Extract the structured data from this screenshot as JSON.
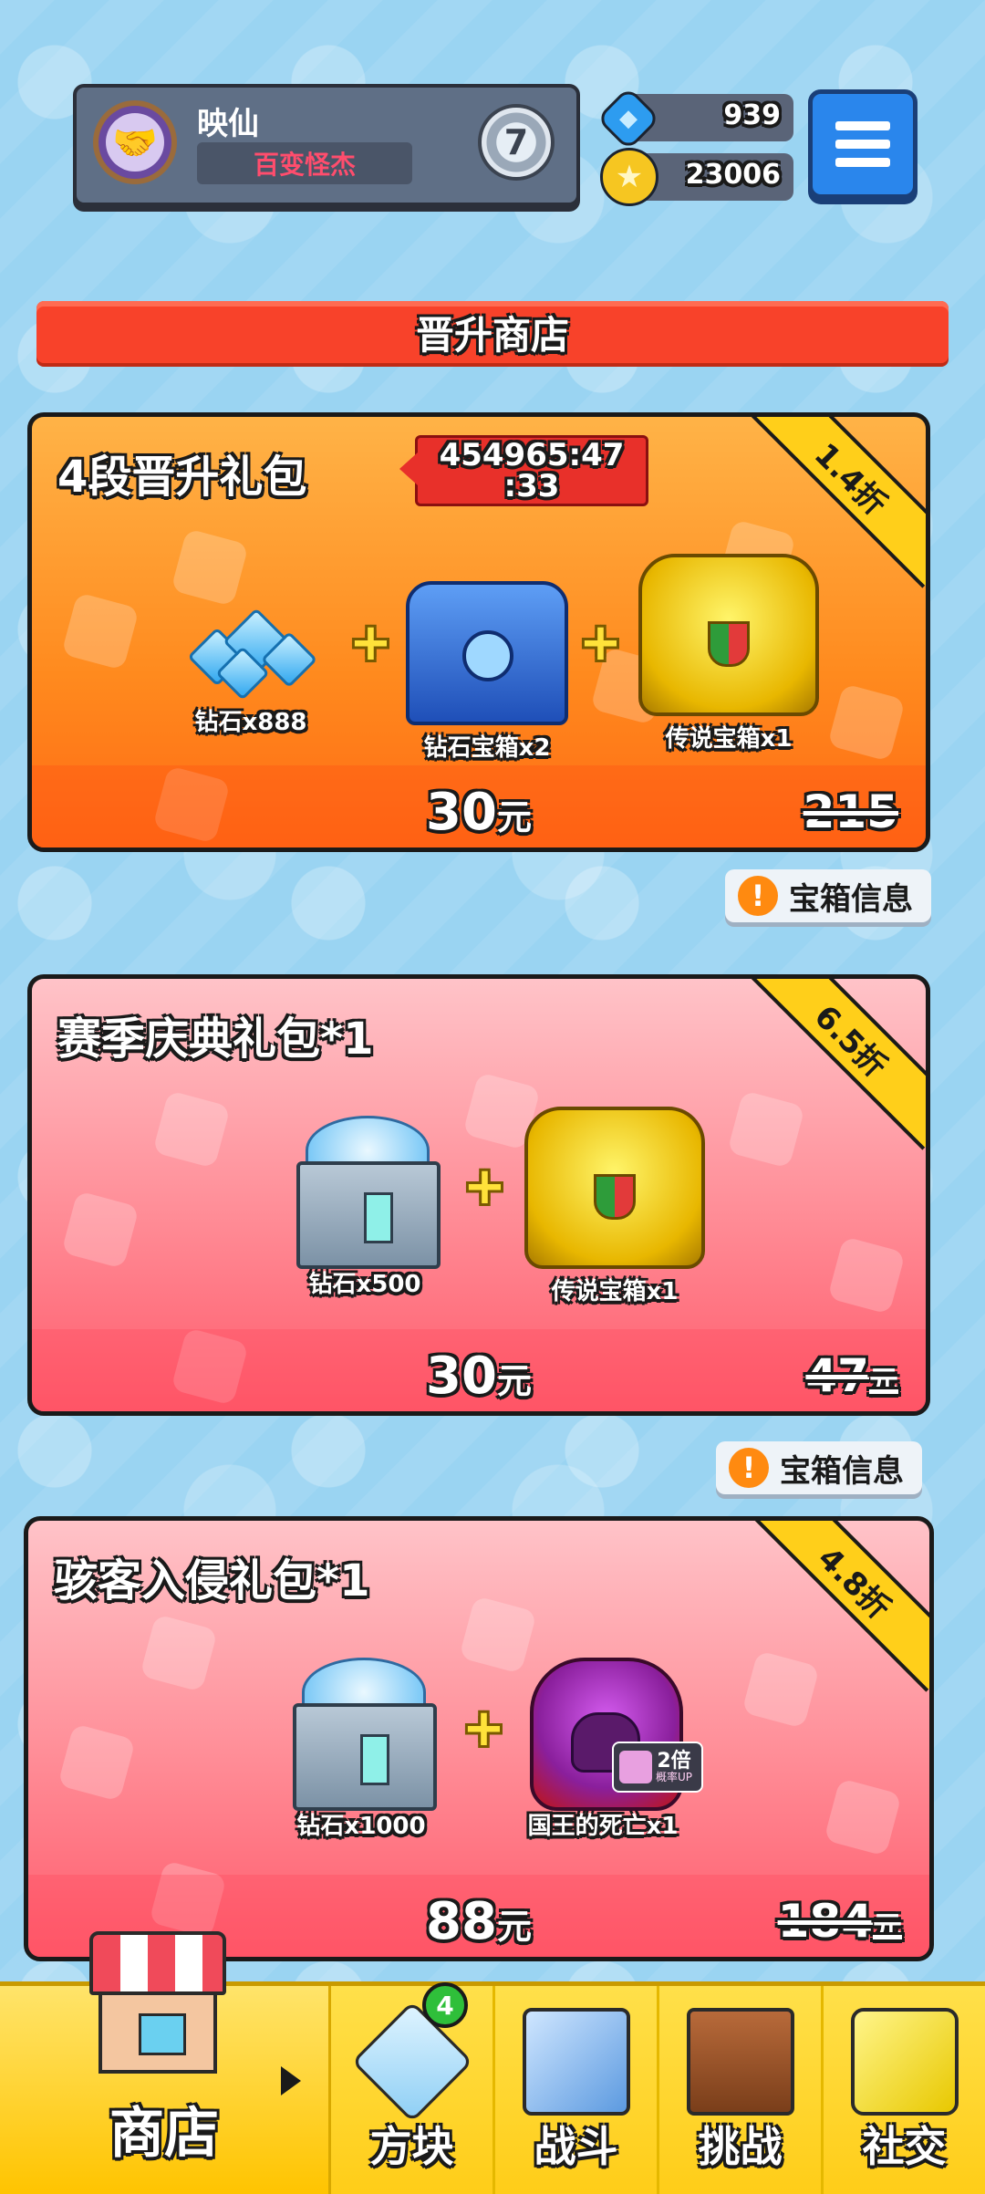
{
  "header": {
    "player_name": "映仙",
    "player_title": "百变怪杰",
    "rank": "7",
    "gems": "939",
    "coins": "23006"
  },
  "section_title": "晋升商店",
  "cards": [
    {
      "title": "4段晋升礼包",
      "timer_line1": "454965:47",
      "timer_line2": ":33",
      "discount": "1.4折",
      "items": [
        "钻石x888",
        "钻石宝箱x2",
        "传说宝箱x1"
      ],
      "price": "30",
      "price_unit": "元",
      "old_price": "215",
      "old_unit": ""
    },
    {
      "title": "赛季庆典礼包*1",
      "discount": "6.5折",
      "items": [
        "钻石x500",
        "传说宝箱x1"
      ],
      "price": "30",
      "price_unit": "元",
      "old_price": "47",
      "old_unit": "元"
    },
    {
      "title": "骇客入侵礼包*1",
      "discount": "4.8折",
      "items": [
        "钻石x1000",
        "国王的死亡x1"
      ],
      "badge_main": "2倍",
      "badge_sub": "概率UP",
      "price": "88",
      "price_unit": "元",
      "old_price": "184",
      "old_unit": "元"
    }
  ],
  "info_button": "宝箱信息",
  "nav": {
    "shop": "商店",
    "blocks": "方块",
    "blocks_badge": "4",
    "battle": "战斗",
    "challenge": "挑战",
    "social": "社交"
  },
  "icons": {
    "gem": "gem-icon",
    "coin": "coin-icon",
    "menu": "hamburger-icon",
    "info": "exclamation-icon"
  },
  "colors": {
    "banner": "#f8422a",
    "ribbon": "#ffcf1a",
    "nav_bg": "#ffd21a",
    "menu_button": "#2a86ec"
  }
}
